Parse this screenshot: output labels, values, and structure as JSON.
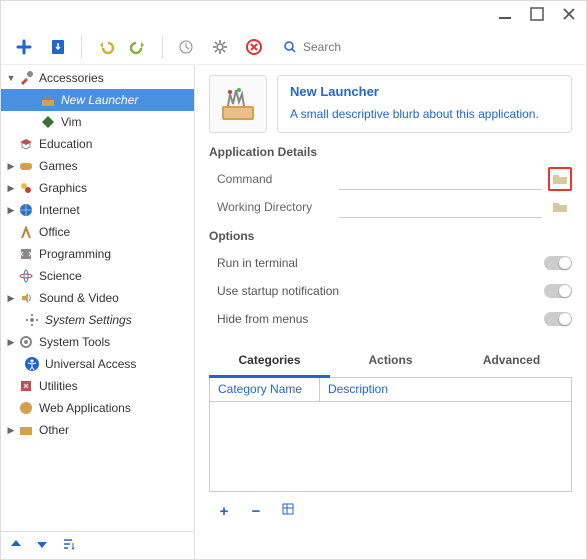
{
  "window_controls": {
    "min": "minimize",
    "max": "maximize",
    "close": "close"
  },
  "search": {
    "placeholder": "Search"
  },
  "tree": {
    "accessories": "Accessories",
    "new_launcher": "New Launcher",
    "vim": "Vim",
    "education": "Education",
    "games": "Games",
    "graphics": "Graphics",
    "internet": "Internet",
    "office": "Office",
    "programming": "Programming",
    "science": "Science",
    "sound_video": "Sound & Video",
    "system_settings": "System Settings",
    "system_tools": "System Tools",
    "universal_access": "Universal Access",
    "utilities": "Utilities",
    "web_applications": "Web Applications",
    "other": "Other"
  },
  "details": {
    "title": "New Launcher",
    "blurb": "A small descriptive blurb about this application.",
    "section_app": "Application Details",
    "command_label": "Command",
    "workdir_label": "Working Directory",
    "section_opts": "Options",
    "opt_terminal": "Run in terminal",
    "opt_startup": "Use startup notification",
    "opt_hide": "Hide from menus"
  },
  "tabs": {
    "categories": "Categories",
    "actions": "Actions",
    "advanced": "Advanced"
  },
  "table": {
    "col_name": "Category Name",
    "col_desc": "Description"
  }
}
